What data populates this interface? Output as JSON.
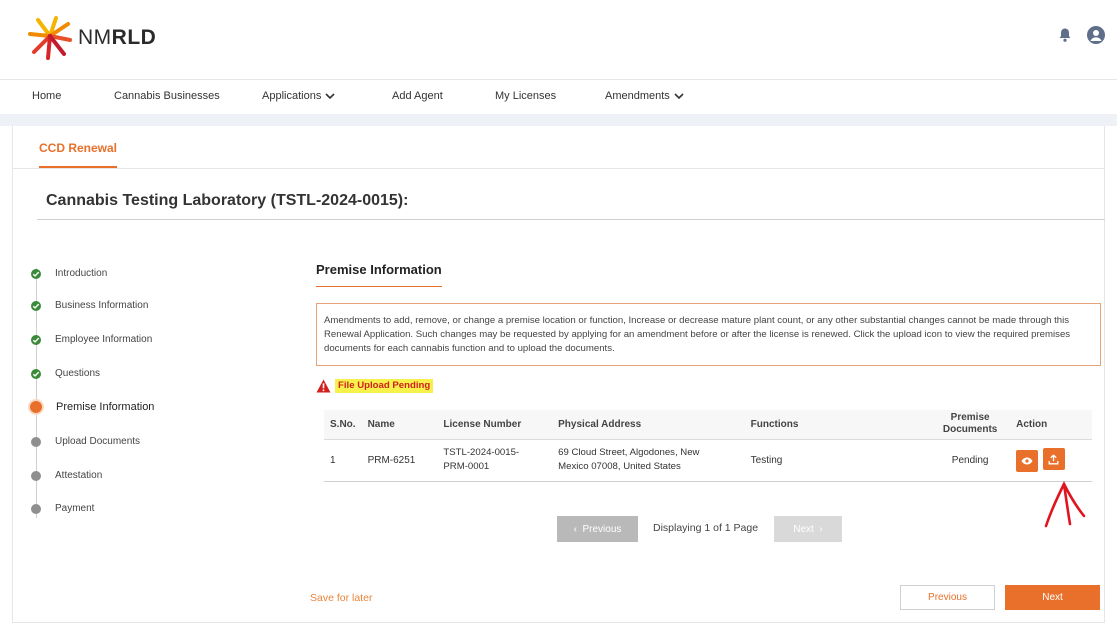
{
  "brand": {
    "name_light": "NM",
    "name_bold": "RLD"
  },
  "nav": {
    "items": [
      {
        "label": "Home"
      },
      {
        "label": "Cannabis Businesses"
      },
      {
        "label": "Applications"
      },
      {
        "label": "Add Agent"
      },
      {
        "label": "My Licenses"
      },
      {
        "label": "Amendments"
      }
    ]
  },
  "tab": {
    "label": "CCD Renewal"
  },
  "page": {
    "title": "Cannabis Testing Laboratory (TSTL-2024-0015):"
  },
  "steps": [
    {
      "label": "Introduction",
      "state": "done"
    },
    {
      "label": "Business Information",
      "state": "done"
    },
    {
      "label": "Employee Information",
      "state": "done"
    },
    {
      "label": "Questions",
      "state": "done"
    },
    {
      "label": "Premise Information",
      "state": "current"
    },
    {
      "label": "Upload Documents",
      "state": "pending"
    },
    {
      "label": "Attestation",
      "state": "pending"
    },
    {
      "label": "Payment",
      "state": "pending"
    }
  ],
  "section": {
    "title": "Premise Information",
    "notice": "Amendments to add, remove, or change a premise location or function, Increase or decrease mature plant count, or any other substantial changes cannot be made through this Renewal Application. Such changes may be requested by applying for an amendment before or after the license is renewed. Click the upload icon to view the required premises documents for each cannabis function and to upload the documents.",
    "warning": "File Upload Pending"
  },
  "table": {
    "headers": [
      "S.No.",
      "Name",
      "License Number",
      "Physical Address",
      "Functions",
      "Premise Documents",
      "Action"
    ],
    "rows": [
      {
        "sno": "1",
        "name": "PRM-6251",
        "license_line1": "TSTL-2024-0015-",
        "license_line2": "PRM-0001",
        "address": "69 Cloud Street, Algodones, New Mexico 07008, United States",
        "functions": "Testing",
        "documents": "Pending"
      }
    ]
  },
  "pagination": {
    "prev": "Previous",
    "text": "Displaying 1 of 1 Page",
    "next": "Next"
  },
  "footer": {
    "save_later": "Save for later",
    "previous": "Previous",
    "next": "Next"
  },
  "colors": {
    "accent": "#e8702a",
    "done": "#3a8a3a",
    "pending": "#8f8f8f",
    "warning": "#d21f1f",
    "highlight": "#f7f24b"
  }
}
